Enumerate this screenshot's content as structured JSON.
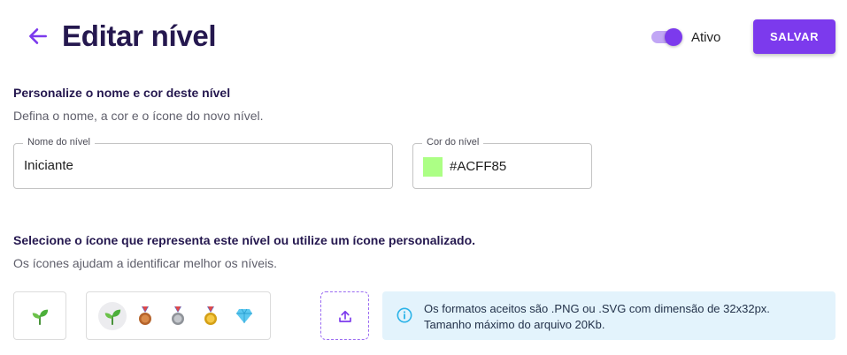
{
  "header": {
    "title": "Editar nível",
    "toggle_label": "Ativo",
    "toggle_on": true,
    "save_label": "SALVAR"
  },
  "colors": {
    "primary": "#7c3aed",
    "title": "#25184f",
    "info_bg": "#e3f3fc",
    "info_icon": "#2bb3e8"
  },
  "section_name": {
    "title": "Personalize o nome e cor deste nível",
    "subtitle": "Defina o nome, a cor e o ícone do novo nível."
  },
  "name_field": {
    "label": "Nome do nível",
    "value": "Iniciante"
  },
  "color_field": {
    "label": "Cor do nível",
    "value": "#ACFF85",
    "swatch": "#ACFF85"
  },
  "section_icon": {
    "title": "Selecione o ícone que representa este nível ou utilize um ícone personalizado.",
    "subtitle": "Os ícones ajudam a identificar melhor os níveis."
  },
  "icons": {
    "current": "seedling-icon",
    "options": [
      "seedling-icon",
      "bronze-medal-icon",
      "silver-medal-icon",
      "gold-medal-icon",
      "diamond-icon"
    ],
    "selected_index": 0
  },
  "info": {
    "line1": "Os formatos aceitos são .PNG ou .SVG com dimensão de 32x32px.",
    "line2": "Tamanho máximo do arquivo 20Kb."
  }
}
